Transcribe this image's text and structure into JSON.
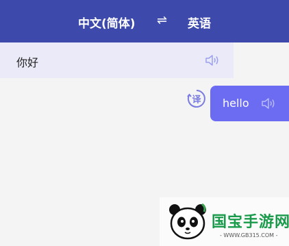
{
  "header": {
    "source_language": "中文(简体)",
    "swap_icon": "⇌",
    "target_language": "英语"
  },
  "source": {
    "text": "你好",
    "speaker_icon": "speaker-icon"
  },
  "translation": {
    "badge_icon": "translate-badge-icon",
    "badge_text": "译",
    "text": "hello",
    "speaker_icon": "speaker-icon"
  },
  "watermark": {
    "title": "国宝手游网",
    "url": "- WWW.GB315.COM -"
  },
  "colors": {
    "header_bg": "#3d4aab",
    "source_bubble_bg": "#ebeaf8",
    "translation_bubble_bg": "#6c6cf2",
    "speaker_color": "#9aa0f0"
  }
}
